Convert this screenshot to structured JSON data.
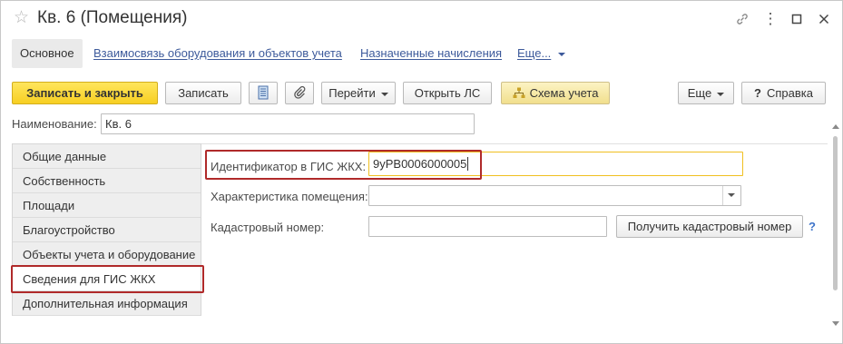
{
  "window": {
    "title": "Кв. 6 (Помещения)",
    "icons": {
      "favorite": "☆",
      "link": "🔗",
      "more": "⋮",
      "maximize": "☐",
      "close": "✕"
    }
  },
  "nav": {
    "active": "Основное",
    "links": [
      "Взаимосвязь оборудования и объектов учета",
      "Назначенные начисления",
      "Еще..."
    ]
  },
  "toolbar": {
    "save_close": "Записать и закрыть",
    "save": "Записать",
    "goto": "Перейти",
    "open_ls": "Открыть ЛС",
    "scheme": "Схема учета",
    "more": "Еще",
    "help": "Справка"
  },
  "name_field": {
    "label": "Наименование:",
    "value": "Кв. 6"
  },
  "sections": [
    "Общие данные",
    "Собственность",
    "Площади",
    "Благоустройство",
    "Объекты учета и оборудование",
    "Сведения для ГИС ЖКХ",
    "Дополнительная информация"
  ],
  "active_section_index": 5,
  "form": {
    "gis_id_label": "Идентификатор в ГИС ЖКХ:",
    "gis_id_value": "9yPB0006000005",
    "characteristic_label": "Характеристика помещения:",
    "characteristic_value": "",
    "cadastral_label": "Кадастровый номер:",
    "cadastral_value": "",
    "get_cadastral_button": "Получить кадастровый номер",
    "help_mark": "?"
  },
  "colors": {
    "primary_button": "#f7cf22",
    "link": "#3d5a9b",
    "highlight_border": "#b02a2a",
    "focus_border": "#f0c020"
  }
}
